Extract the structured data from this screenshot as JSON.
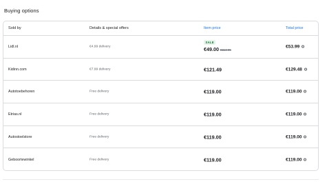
{
  "heading": "Buying options",
  "columns": {
    "sold_by": "Sold by",
    "details": "Details & special offers",
    "item_price": "Item price",
    "total_price": "Total price"
  },
  "rows": [
    {
      "seller": "Lidl.nl",
      "details": "€4.99 delivery",
      "badge": "SALE",
      "item_price": "€49.00",
      "original_price": "€114.95",
      "total": "€53.99"
    },
    {
      "seller": "Kidinn.com",
      "details": "€7.99 delivery",
      "item_price": "€121.49",
      "total": "€129.48"
    },
    {
      "seller": "Autotoebehoren",
      "details": "Free delivery",
      "item_price": "€119.00",
      "total": "€119.00"
    },
    {
      "seller": "Etrias.nl",
      "details": "Free delivery",
      "item_price": "€119.00",
      "total": "€119.00"
    },
    {
      "seller": "Autostoelstore",
      "details": "Free delivery",
      "item_price": "€119.00",
      "total": "€119.00"
    },
    {
      "seller": "Geboortewinkel",
      "details": "Free delivery",
      "item_price": "€119.00",
      "total": "€119.00"
    }
  ],
  "colors": {
    "accent": "#1a73e8",
    "sale_badge_text": "#137333",
    "sale_badge_bg": "#e6f4ea",
    "border": "#dadce0"
  },
  "icons": {
    "info": "info-icon"
  }
}
